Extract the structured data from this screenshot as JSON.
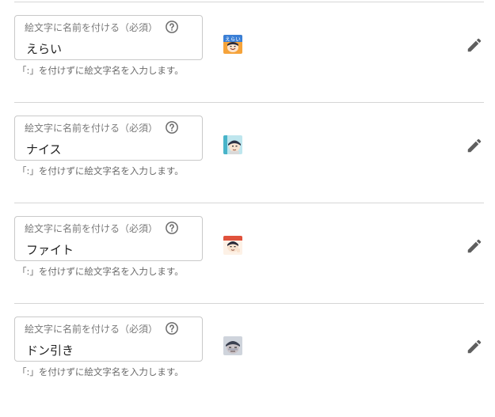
{
  "field_label": "絵文字に名前を付ける（必須）",
  "hint": "「:」を付けずに絵文字名を入力します。",
  "icons": {
    "help": "help-circle-icon",
    "edit": "pencil-icon"
  },
  "rows": [
    {
      "value": "えらい",
      "emoji_badge": "えらい"
    },
    {
      "value": "ナイス"
    },
    {
      "value": "ファイト"
    },
    {
      "value": "ドン引き"
    }
  ]
}
